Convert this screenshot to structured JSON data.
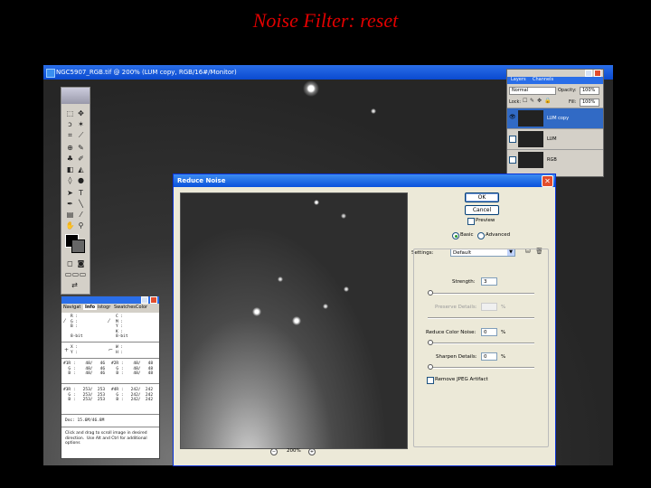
{
  "slide": {
    "title": "Noise Filter: reset"
  },
  "document": {
    "title": "NGC5907_RGB.tif @ 200% (LUM copy, RGB/16#/Monitor)",
    "zoom_label": "200%"
  },
  "layers_panel": {
    "tabs": [
      "Layers",
      "Channels"
    ],
    "blend_mode": "Normal",
    "opacity_label": "Opacity:",
    "opacity_value": "100%",
    "lock_label": "Lock:",
    "fill_label": "Fill:",
    "fill_value": "100%",
    "layers": [
      {
        "name": "LUM copy",
        "selected": true
      },
      {
        "name": "LUM",
        "selected": false
      },
      {
        "name": "RGB",
        "selected": false
      }
    ]
  },
  "info_panel": {
    "tabs": [
      "Navigat",
      "Info",
      "istogr",
      "Swatches",
      "Color"
    ],
    "block1_left": "C :\nM :\nY :\nK :\n8-bit",
    "block1_left2": "R :\nG :\nB :\n\n8-bit",
    "block1_right": "C :\nM :\nY :\nK :\n8-bit",
    "xy": "X :\nY :",
    "wh": "W :\nH :",
    "s1_left": "#1R :    48/   46\n  G :    48/   46\n  B :    48/   46",
    "s1_right": "#2R :    48/   48\n  G :    48/   48\n  B :    48/   48",
    "s2_left": "#3R :   253/  253\n  G :   253/  253\n  B :   253/  253",
    "s2_right": "#4R :   242/  242\n  G :   242/  242\n  B :   242/  242",
    "doc": "Doc: 15.6M/46.8M",
    "hint": "Click and drag to scroll image in desired\ndirection.  Use Alt and Ctrl for additional\noptions"
  },
  "dialog": {
    "title": "Reduce Noise",
    "ok": "OK",
    "cancel": "Cancel",
    "preview": "Preview",
    "basic": "Basic",
    "advanced": "Advanced",
    "settings_label": "Settings:",
    "settings_value": "Default",
    "strength_label": "Strength:",
    "strength_value": "3",
    "preserve_label": "Preserve Details:",
    "preserve_value": "",
    "preserve_unit": "%",
    "color_noise_label": "Reduce Color Noise:",
    "color_noise_value": "0",
    "color_noise_unit": "%",
    "sharpen_label": "Sharpen Details:",
    "sharpen_value": "0",
    "sharpen_unit": "%",
    "jpeg_label": "Remove JPEG Artifact",
    "zoom": "200%",
    "zoom_minus": "−",
    "zoom_plus": "+"
  }
}
